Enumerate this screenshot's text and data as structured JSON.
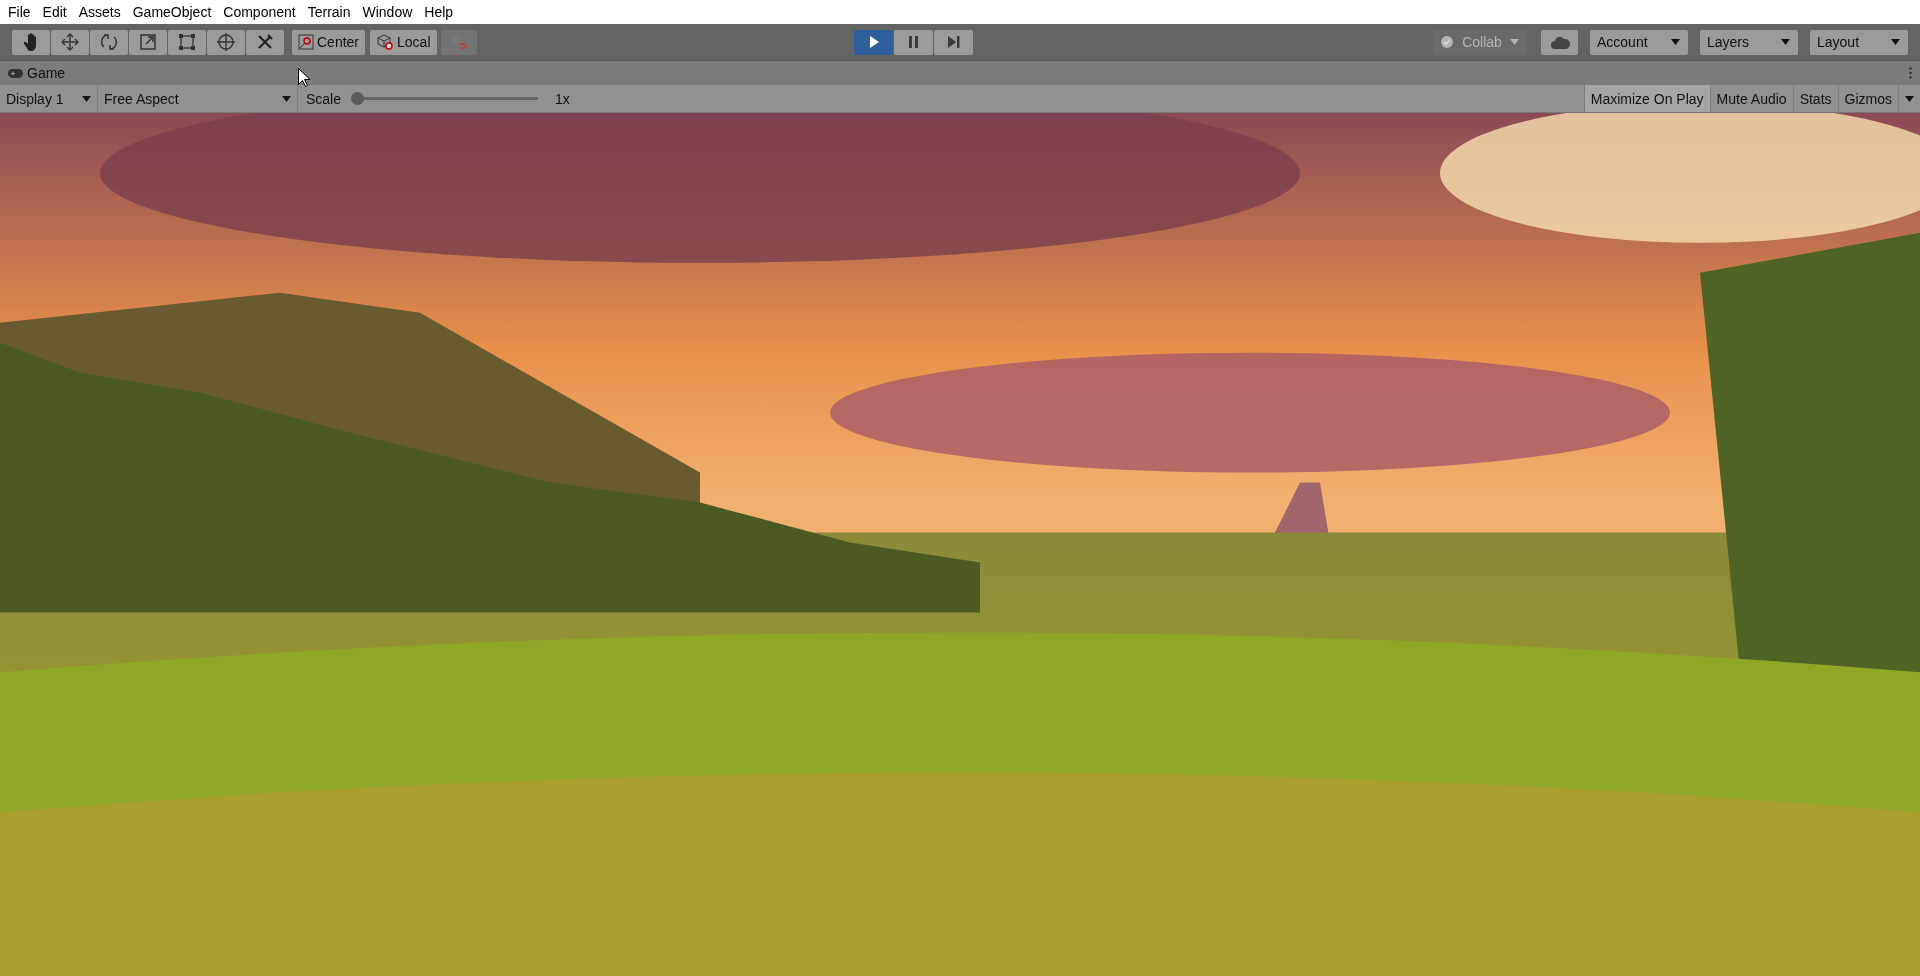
{
  "menu": [
    "File",
    "Edit",
    "Assets",
    "GameObject",
    "Component",
    "Terrain",
    "Window",
    "Help"
  ],
  "tools": [
    {
      "kind": "hand"
    },
    {
      "kind": "move"
    },
    {
      "kind": "rotate"
    },
    {
      "kind": "scale"
    },
    {
      "kind": "rect"
    },
    {
      "kind": "transform"
    },
    {
      "kind": "custom"
    }
  ],
  "pivot_buttons": [
    {
      "kind": "pivot",
      "label": "Center"
    },
    {
      "kind": "rotation",
      "label": "Local"
    }
  ],
  "playback": [
    {
      "kind": "play",
      "selected": true
    },
    {
      "kind": "pause",
      "selected": false
    },
    {
      "kind": "step",
      "selected": false
    }
  ],
  "collab": {
    "label": "Collab",
    "disabled": true
  },
  "dropdowns": [
    "Account",
    "Layers",
    "Layout"
  ],
  "game_tab": {
    "label": "Game"
  },
  "game_toolbar": {
    "display": "Display 1",
    "aspect": "Free Aspect",
    "scale": {
      "label": "Scale",
      "level": 0,
      "reading": "1x"
    },
    "toggles": [
      {
        "label": "Maximize On Play",
        "on": true
      },
      {
        "label": "Mute Audio",
        "on": false
      },
      {
        "label": "Stats",
        "on": false
      },
      {
        "label": "Gizmos",
        "on": false
      }
    ]
  }
}
